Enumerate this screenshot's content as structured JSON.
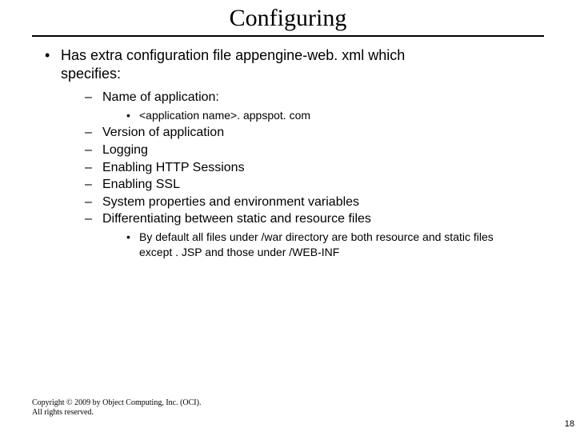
{
  "title": "Configuring",
  "main_bullet_line1": "Has extra configuration file appengine-web. xml which",
  "main_bullet_line2": "specifies:",
  "sub_items": {
    "name_app": "Name of application:",
    "name_app_sub": "<application name>. appspot. com",
    "version": "Version of application",
    "logging": "Logging",
    "http_sessions": "Enabling HTTP Sessions",
    "ssl": "Enabling SSL",
    "sysprops": "System properties and environment variables",
    "diff_static": "Differentiating between static and resource files",
    "diff_static_sub_l1": "By default all files under /war directory are both resource and static files",
    "diff_static_sub_l2": "except . JSP and those under /WEB-INF"
  },
  "footer_line1": "Copyright © 2009 by Object Computing, Inc. (OCI).",
  "footer_line2": "All rights reserved.",
  "page_number": "18"
}
